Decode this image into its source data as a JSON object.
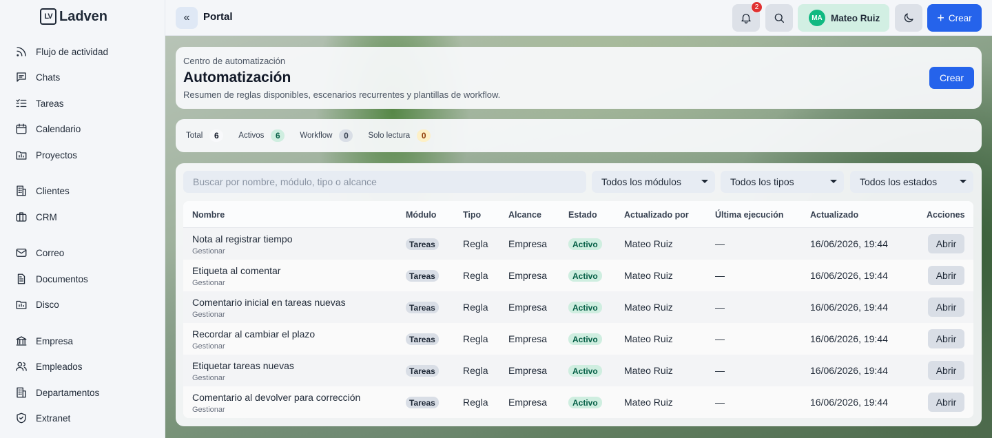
{
  "brand": {
    "logo_mark": "LV",
    "name": "Ladven"
  },
  "sidebar": {
    "items": [
      {
        "label": "Flujo de actividad",
        "icon": "rss-icon"
      },
      {
        "label": "Chats",
        "icon": "chat-icon"
      },
      {
        "label": "Tareas",
        "icon": "tasks-icon"
      },
      {
        "label": "Calendario",
        "icon": "calendar-icon"
      },
      {
        "label": "Proyectos",
        "icon": "folder-icon"
      },
      {
        "label": "Clientes",
        "icon": "building-icon"
      },
      {
        "label": "CRM",
        "icon": "briefcase-icon"
      },
      {
        "label": "Correo",
        "icon": "mail-icon"
      },
      {
        "label": "Documentos",
        "icon": "document-icon"
      },
      {
        "label": "Disco",
        "icon": "folder-icon"
      },
      {
        "label": "Empresa",
        "icon": "bank-icon"
      },
      {
        "label": "Empleados",
        "icon": "users-icon"
      },
      {
        "label": "Departamentos",
        "icon": "building-icon"
      },
      {
        "label": "Extranet",
        "icon": "shield-icon"
      }
    ]
  },
  "topbar": {
    "collapse_glyph": "«",
    "title": "Portal",
    "notification_count": "2",
    "user_initials": "MA",
    "user_name": "Mateo Ruiz",
    "create_label": "Crear",
    "create_glyph": "+"
  },
  "header": {
    "kicker": "Centro de automatización",
    "title": "Automatización",
    "subtitle": "Resumen de reglas disponibles, escenarios recurrentes y plantillas de workflow.",
    "create_label": "Crear"
  },
  "stats": [
    {
      "label": "Total",
      "count": "6",
      "bg": "#f8f9fb",
      "fg": "#111827"
    },
    {
      "label": "Activos",
      "count": "6",
      "bg": "#cfeee0",
      "fg": "#065f46"
    },
    {
      "label": "Workflow",
      "count": "0",
      "bg": "#d9dee6",
      "fg": "#374151"
    },
    {
      "label": "Solo lectura",
      "count": "0",
      "bg": "#fdf0c7",
      "fg": "#92400e"
    }
  ],
  "filters": {
    "search_placeholder": "Buscar por nombre, módulo, tipo o alcance",
    "module": "Todos los módulos",
    "type": "Todos los tipos",
    "state": "Todos los estados"
  },
  "table": {
    "columns": [
      "Nombre",
      "Módulo",
      "Tipo",
      "Alcance",
      "Estado",
      "Actualizado por",
      "Última ejecución",
      "Actualizado",
      "Acciones"
    ],
    "rows": [
      {
        "name": "Nota al registrar tiempo",
        "sub": "Gestionar",
        "module": "Tareas",
        "type": "Regla",
        "scope": "Empresa",
        "state": "Activo",
        "by": "Mateo Ruiz",
        "last_run": "—",
        "updated": "16/06/2026, 19:44",
        "action": "Abrir"
      },
      {
        "name": "Etiqueta al comentar",
        "sub": "Gestionar",
        "module": "Tareas",
        "type": "Regla",
        "scope": "Empresa",
        "state": "Activo",
        "by": "Mateo Ruiz",
        "last_run": "—",
        "updated": "16/06/2026, 19:44",
        "action": "Abrir"
      },
      {
        "name": "Comentario inicial en tareas nuevas",
        "sub": "Gestionar",
        "module": "Tareas",
        "type": "Regla",
        "scope": "Empresa",
        "state": "Activo",
        "by": "Mateo Ruiz",
        "last_run": "—",
        "updated": "16/06/2026, 19:44",
        "action": "Abrir"
      },
      {
        "name": "Recordar al cambiar el plazo",
        "sub": "Gestionar",
        "module": "Tareas",
        "type": "Regla",
        "scope": "Empresa",
        "state": "Activo",
        "by": "Mateo Ruiz",
        "last_run": "—",
        "updated": "16/06/2026, 19:44",
        "action": "Abrir"
      },
      {
        "name": "Etiquetar tareas nuevas",
        "sub": "Gestionar",
        "module": "Tareas",
        "type": "Regla",
        "scope": "Empresa",
        "state": "Activo",
        "by": "Mateo Ruiz",
        "last_run": "—",
        "updated": "16/06/2026, 19:44",
        "action": "Abrir"
      },
      {
        "name": "Comentario al devolver para corrección",
        "sub": "Gestionar",
        "module": "Tareas",
        "type": "Regla",
        "scope": "Empresa",
        "state": "Activo",
        "by": "Mateo Ruiz",
        "last_run": "—",
        "updated": "16/06/2026, 19:44",
        "action": "Abrir"
      }
    ]
  },
  "colors": {
    "accent": "#2563eb",
    "active": "#cfeee0",
    "badge": "#e03131"
  }
}
